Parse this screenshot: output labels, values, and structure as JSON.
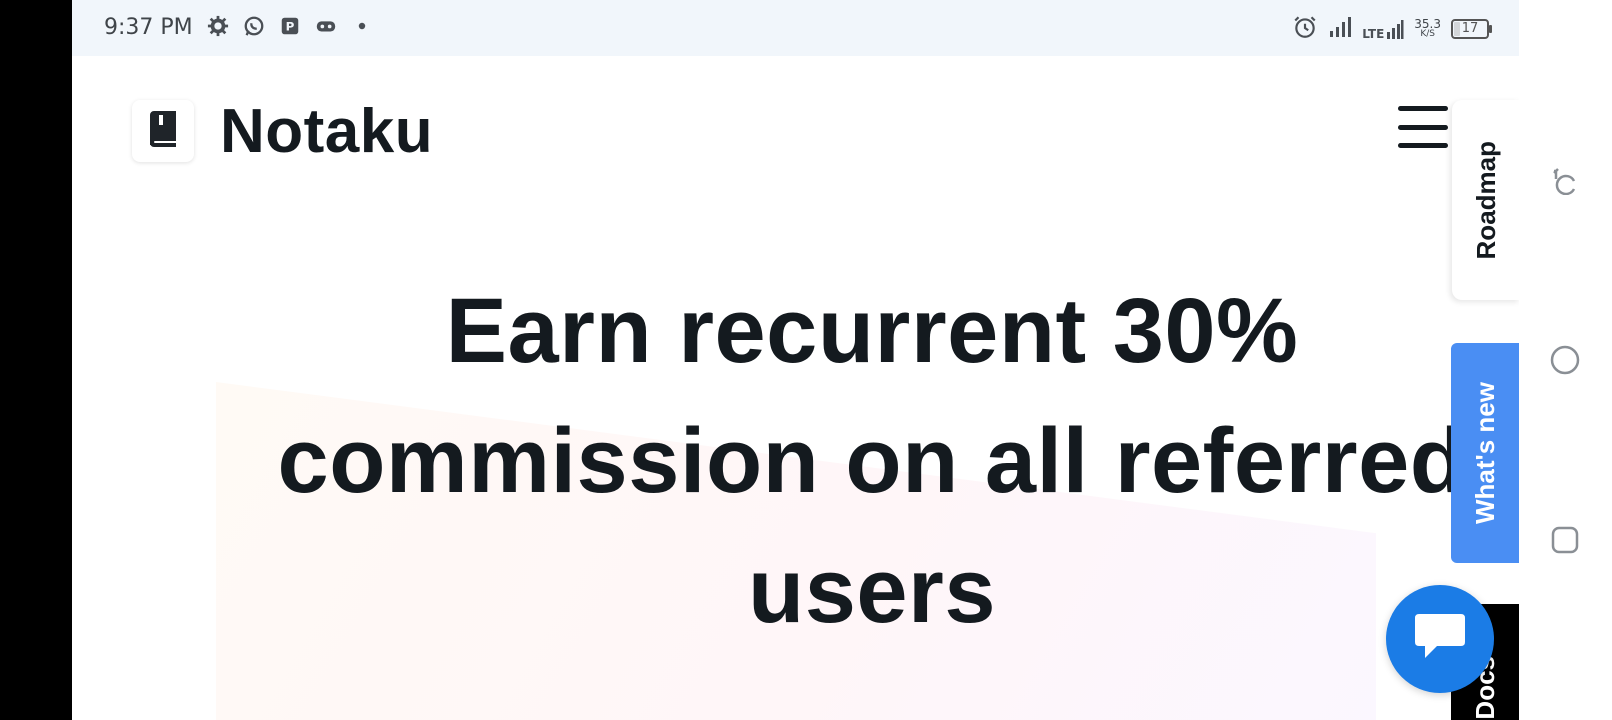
{
  "status_bar": {
    "time": "9:37 PM",
    "net_type": "LTE",
    "net_speed_value": "35.3",
    "net_speed_unit": "K/S",
    "battery_level": "17",
    "icons_left": [
      "settings-icon",
      "whatsapp-icon",
      "pinned-app-icon",
      "game-controller-icon",
      "notification-dot-icon"
    ],
    "icons_right": [
      "alarm-icon",
      "signal-icon",
      "lte-signal-icon",
      "battery-icon"
    ]
  },
  "header": {
    "brand_name": "Notaku",
    "logo_icon": "book-icon",
    "menu_icon": "hamburger-menu-icon"
  },
  "hero": {
    "title": "Earn recurrent 30% commission on all referred users"
  },
  "side_tabs": {
    "roadmap_label": "Roadmap",
    "whats_new_label": "What's new",
    "docs_label": "Docs"
  },
  "chat": {
    "icon": "chat-bubble-icon"
  },
  "nav": {
    "back_icon": "back-icon",
    "home_icon": "home-icon",
    "recents_icon": "recents-icon"
  },
  "colors": {
    "accent_blue": "#4a8ef3",
    "chat_blue": "#1b7ce6",
    "text_dark": "#141a1f",
    "status_bg": "#f1f6fb"
  }
}
